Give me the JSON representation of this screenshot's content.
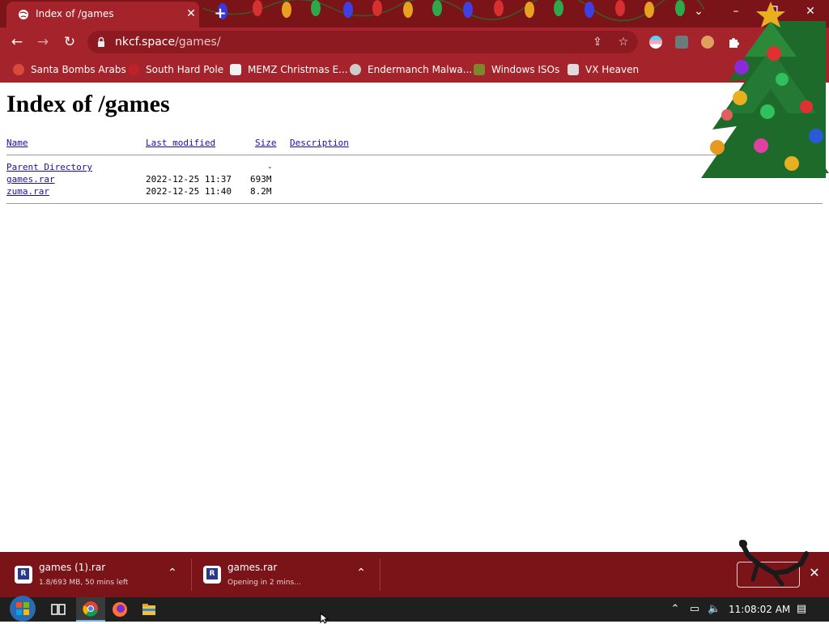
{
  "tab": {
    "title": "Index of /games",
    "close_glyph": "✕"
  },
  "new_tab_glyph": "+",
  "window_controls": {
    "tab_search": "⌄",
    "minimize": "–",
    "restore": "❐",
    "close": "✕"
  },
  "nav": {
    "back": "←",
    "forward": "→",
    "reload": "↻"
  },
  "address": {
    "host": "nkcf.space",
    "path": "/games/"
  },
  "omnibox_icons": {
    "share": "⇪",
    "bookmark": "☆"
  },
  "menu_glyph": "⋮",
  "bookmarks": [
    {
      "label": "Santa Bombs Arabs",
      "icon_color": "#d94a3a"
    },
    {
      "label": "South Hard Pole",
      "icon_color": "#c0202a"
    },
    {
      "label": "MEMZ Christmas E...",
      "icon_color": "#f2f2f2"
    },
    {
      "label": "Endermanch Malwa...",
      "icon_color": "#cccccc"
    },
    {
      "label": "Windows ISOs",
      "icon_color": "#7a8a2a"
    },
    {
      "label": "VX Heaven",
      "icon_color": "#dddddd"
    }
  ],
  "page": {
    "heading": "Index of /games",
    "columns": {
      "name": "Name",
      "modified": "Last modified",
      "size": "Size",
      "description": "Description"
    },
    "rows": [
      {
        "name": "Parent Directory",
        "modified": "",
        "size": "-"
      },
      {
        "name": "games.rar",
        "modified": "2022-12-25 11:37",
        "size": "693M"
      },
      {
        "name": "zuma.rar",
        "modified": "2022-12-25 11:40",
        "size": "8.2M"
      }
    ]
  },
  "downloads": [
    {
      "name": "games (1).rar",
      "status": "1.8/693 MB, 50 mins left"
    },
    {
      "name": "games.rar",
      "status": "Opening in 2 mins..."
    }
  ],
  "download_chevron": "⌃",
  "download_close": "✕",
  "taskbar": {
    "time": "11:08:02 AM"
  },
  "tray_glyphs": {
    "chevron": "⌃",
    "network": "▭",
    "volume": "🔈",
    "notify": "▤"
  },
  "colors": {
    "accent": "#a5232a",
    "dark": "#7a1418",
    "link": "#1a0dab"
  }
}
